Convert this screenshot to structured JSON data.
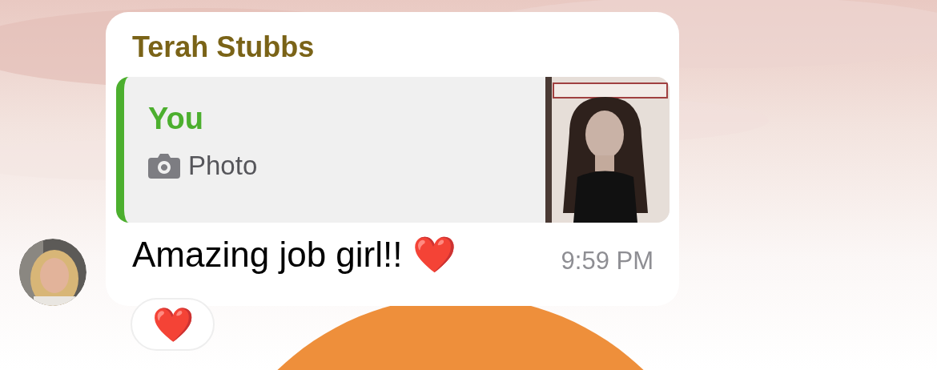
{
  "chat": {
    "sender": "Terah Stubbs",
    "reply": {
      "author": "You",
      "label": "Photo"
    },
    "message": "Amazing job girl!! ❤️",
    "time": "9:59 PM",
    "reactions": [
      {
        "emoji": "❤️"
      }
    ]
  }
}
